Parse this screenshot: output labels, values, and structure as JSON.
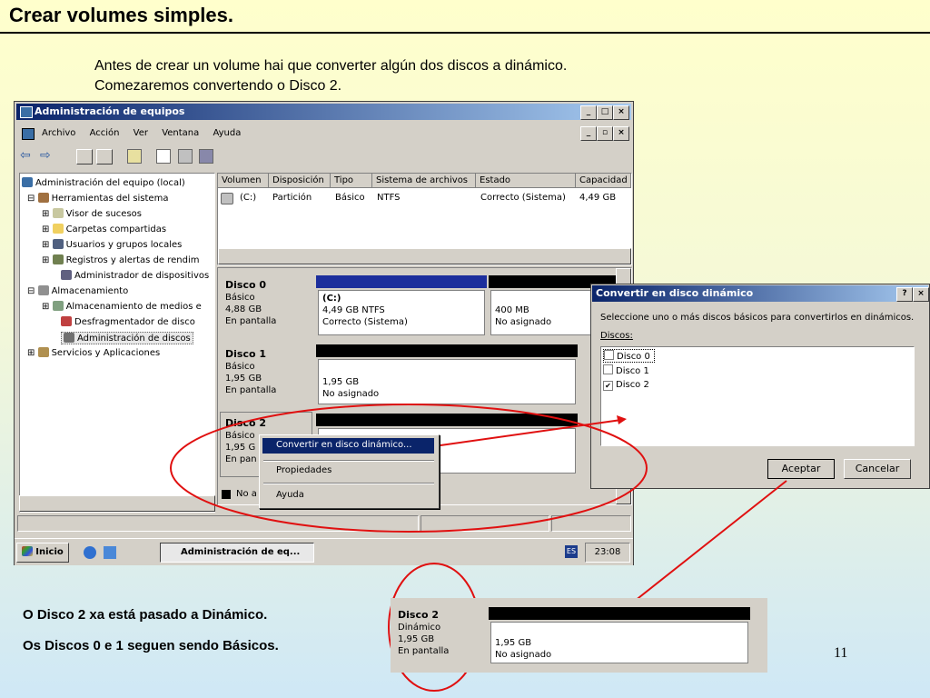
{
  "slide": {
    "title": "Crear volumes simples.",
    "intro_line1": "Antes de crear un volume hai que converter algún dos discos a dinámico.",
    "intro_line2": "Comezaremos convertendo o Disco 2.",
    "caption_line1": "O Disco 2 xa está pasado a Dinámico.",
    "caption_line2": "Os Discos 0 e 1 seguen sendo Básicos.",
    "page_number": "11",
    "arrow_color": "#e01010"
  },
  "window": {
    "title": "Administración de equipos",
    "controls": [
      "_",
      "□",
      "×"
    ],
    "menu": [
      "Archivo",
      "Acción",
      "Ver",
      "Ventana",
      "Ayuda"
    ],
    "child_controls": [
      "_",
      "▫",
      "×"
    ],
    "toolbar_icons": [
      "back-icon",
      "forward-icon",
      "up-folder-icon",
      "show-tree-icon",
      "properties-icon",
      "refresh-icon",
      "export-icon",
      "help-icon"
    ]
  },
  "tree": {
    "root": "Administración del equipo (local)",
    "items": [
      "Herramientas del sistema",
      "Visor de sucesos",
      "Carpetas compartidas",
      "Usuarios y grupos locales",
      "Registros y alertas de rendim",
      "Administrador de dispositivos",
      "Almacenamiento",
      "Almacenamiento de medios e",
      "Desfragmentador de disco",
      "Administración de discos",
      "Servicios y Aplicaciones"
    ]
  },
  "volume_table": {
    "columns": [
      "Volumen",
      "Disposición",
      "Tipo",
      "Sistema de archivos",
      "Estado",
      "Capacidad"
    ],
    "row": {
      "volume": "(C:)",
      "layout": "Partición",
      "type": "Básico",
      "fs": "NTFS",
      "status": "Correcto (Sistema)",
      "capacity": "4,49 GB"
    }
  },
  "disks": [
    {
      "name": "Disco 0",
      "type": "Básico",
      "size": "4,88 GB",
      "status": "En pantalla",
      "p1_name": "(C:)",
      "p1_size": "4,49 GB NTFS",
      "p1_status": "Correcto (Sistema)",
      "p2_size": "400 MB",
      "p2_status": "No asignado"
    },
    {
      "name": "Disco 1",
      "type": "Básico",
      "size": "1,95 GB",
      "status": "En pantalla",
      "p1_size": "1,95 GB",
      "p1_status": "No asignado"
    },
    {
      "name": "Disco 2",
      "type": "Básico",
      "size": "1,95 G",
      "status": "En pan"
    }
  ],
  "legend_partial": "No a",
  "context_menu": {
    "items": [
      "Convertir en disco dinámico...",
      "Propiedades",
      "Ayuda"
    ]
  },
  "dialog": {
    "title": "Convertir en disco dinámico",
    "help": "?",
    "close": "×",
    "instruction": "Seleccione uno o más discos básicos para convertirlos en dinámicos.",
    "list_label": "Discos:",
    "disks": [
      {
        "label": "Disco 0",
        "checked": false
      },
      {
        "label": "Disco 1",
        "checked": false
      },
      {
        "label": "Disco 2",
        "checked": true
      }
    ],
    "ok": "Aceptar",
    "cancel": "Cancelar"
  },
  "taskbar": {
    "start": "Inicio",
    "task": "Administración de eq...",
    "lang": "ES",
    "clock": "23:08"
  },
  "result_disk": {
    "name": "Disco 2",
    "type": "Dinámico",
    "size": "1,95 GB",
    "status": "En pantalla",
    "p_size": "1,95 GB",
    "p_status": "No asignado"
  }
}
